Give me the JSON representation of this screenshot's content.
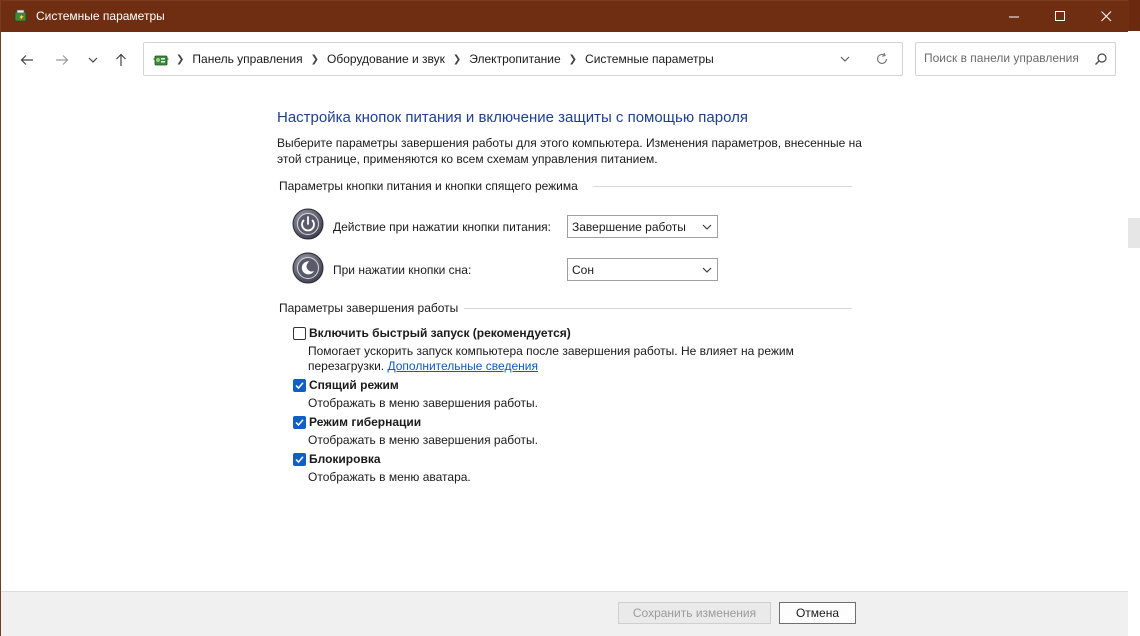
{
  "window": {
    "title": "Системные параметры"
  },
  "nav": {
    "breadcrumbs": [
      "Панель управления",
      "Оборудование и звук",
      "Электропитание",
      "Системные параметры"
    ],
    "search_placeholder": "Поиск в панели управления"
  },
  "page": {
    "heading": "Настройка кнопок питания и включение защиты с помощью пароля",
    "description": "Выберите параметры завершения работы для этого компьютера. Изменения параметров, внесенные на этой странице, применяются ко всем схемам управления питанием.",
    "power_section": {
      "title": "Параметры кнопки питания и кнопки спящего режима",
      "power_button_label": "Действие при нажатии кнопки питания:",
      "power_button_value": "Завершение работы",
      "sleep_button_label": "При нажатии кнопки сна:",
      "sleep_button_value": "Сон"
    },
    "shutdown_section": {
      "title": "Параметры завершения работы",
      "options": [
        {
          "title": "Включить быстрый запуск (рекомендуется)",
          "desc_line1": "Помогает ускорить запуск компьютера после завершения работы. Не влияет на режим",
          "desc_line2": "перезагрузки.",
          "link": "Дополнительные сведения",
          "checked": false
        },
        {
          "title": "Спящий режим",
          "desc": "Отображать в меню завершения работы.",
          "checked": true
        },
        {
          "title": "Режим гибернации",
          "desc": "Отображать в меню завершения работы.",
          "checked": true
        },
        {
          "title": "Блокировка",
          "desc": "Отображать в меню аватара.",
          "checked": true
        }
      ]
    }
  },
  "footer": {
    "save_label": "Сохранить изменения",
    "cancel_label": "Отмена"
  },
  "colors": {
    "titlebar": "#6f2d12",
    "heading": "#1e3f95",
    "link": "#0a5bc4",
    "checkbox": "#0f5fc5"
  }
}
